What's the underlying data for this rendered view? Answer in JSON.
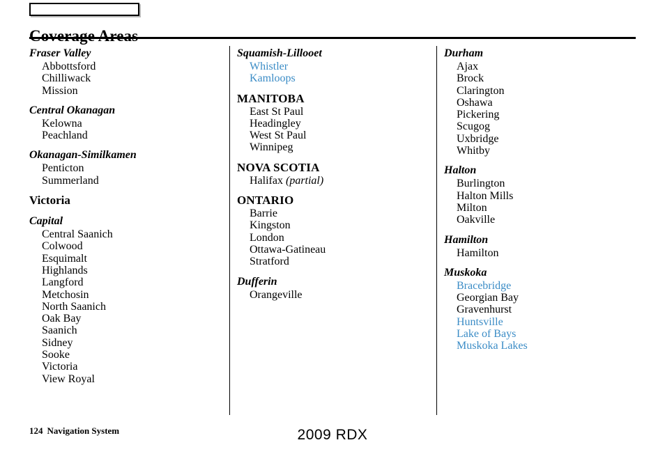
{
  "header": {
    "tab_box_label": "",
    "title": "Coverage Areas"
  },
  "colors": {
    "link": "#3b8cc6",
    "text": "#000000",
    "rule": "#000000"
  },
  "columns": [
    {
      "id": "column-1",
      "groups": [
        {
          "heading": "Fraser Valley",
          "heading_type": "region",
          "cities": [
            {
              "name": "Abbottsford",
              "link": false
            },
            {
              "name": "Chilliwack",
              "link": false
            },
            {
              "name": "Mission",
              "link": false
            }
          ]
        },
        {
          "heading": "Central Okanagan",
          "heading_type": "region",
          "cities": [
            {
              "name": "Kelowna",
              "link": false
            },
            {
              "name": "Peachland",
              "link": false
            }
          ]
        },
        {
          "heading": "Okanagan-Similkamen",
          "heading_type": "region",
          "cities": [
            {
              "name": "Penticton",
              "link": false
            },
            {
              "name": "Summerland",
              "link": false
            }
          ]
        },
        {
          "heading": "Victoria",
          "heading_type": "section",
          "cities": []
        },
        {
          "heading": "Capital",
          "heading_type": "region",
          "cities": [
            {
              "name": "Central Saanich",
              "link": false
            },
            {
              "name": "Colwood",
              "link": false
            },
            {
              "name": "Esquimalt",
              "link": false
            },
            {
              "name": "Highlands",
              "link": false
            },
            {
              "name": "Langford",
              "link": false
            },
            {
              "name": "Metchosin",
              "link": false
            },
            {
              "name": "North Saanich",
              "link": false
            },
            {
              "name": "Oak Bay",
              "link": false
            },
            {
              "name": "Saanich",
              "link": false
            },
            {
              "name": "Sidney",
              "link": false
            },
            {
              "name": "Sooke",
              "link": false
            },
            {
              "name": "Victoria",
              "link": false
            },
            {
              "name": "View Royal",
              "link": false
            }
          ]
        }
      ]
    },
    {
      "id": "column-2",
      "groups": [
        {
          "heading": "Squamish-Lillooet",
          "heading_type": "region",
          "cities": [
            {
              "name": "Whistler",
              "link": true
            },
            {
              "name": "Kamloops",
              "link": true
            }
          ]
        },
        {
          "heading": "MANITOBA",
          "heading_type": "province",
          "cities": [
            {
              "name": "East St Paul",
              "link": false
            },
            {
              "name": "Headingley",
              "link": false
            },
            {
              "name": "West St Paul",
              "link": false
            },
            {
              "name": "Winnipeg",
              "link": false
            }
          ]
        },
        {
          "heading": "NOVA SCOTIA",
          "heading_type": "province",
          "cities": [
            {
              "name": "Halifax",
              "link": false,
              "qualifier": "(partial)"
            }
          ]
        },
        {
          "heading": "ONTARIO",
          "heading_type": "province",
          "cities": [
            {
              "name": "Barrie",
              "link": false
            },
            {
              "name": "Kingston",
              "link": false
            },
            {
              "name": "London",
              "link": false
            },
            {
              "name": "Ottawa-Gatineau",
              "link": false
            },
            {
              "name": "Stratford",
              "link": false
            }
          ]
        },
        {
          "heading": "Dufferin",
          "heading_type": "region",
          "cities": [
            {
              "name": "Orangeville",
              "link": false
            }
          ]
        }
      ]
    },
    {
      "id": "column-3",
      "groups": [
        {
          "heading": "Durham",
          "heading_type": "region",
          "cities": [
            {
              "name": "Ajax",
              "link": false
            },
            {
              "name": "Brock",
              "link": false
            },
            {
              "name": "Clarington",
              "link": false
            },
            {
              "name": "Oshawa",
              "link": false
            },
            {
              "name": "Pickering",
              "link": false
            },
            {
              "name": "Scugog",
              "link": false
            },
            {
              "name": "Uxbridge",
              "link": false
            },
            {
              "name": "Whitby",
              "link": false
            }
          ]
        },
        {
          "heading": "Halton",
          "heading_type": "region",
          "cities": [
            {
              "name": "Burlington",
              "link": false
            },
            {
              "name": "Halton Mills",
              "link": false
            },
            {
              "name": "Milton",
              "link": false
            },
            {
              "name": "Oakville",
              "link": false
            }
          ]
        },
        {
          "heading": "Hamilton",
          "heading_type": "region",
          "cities": [
            {
              "name": "Hamilton",
              "link": false
            }
          ]
        },
        {
          "heading": "Muskoka",
          "heading_type": "region",
          "cities": [
            {
              "name": "Bracebridge",
              "link": true
            },
            {
              "name": "Georgian Bay",
              "link": false
            },
            {
              "name": "Gravenhurst",
              "link": false
            },
            {
              "name": "Huntsville",
              "link": true
            },
            {
              "name": "Lake of Bays",
              "link": true
            },
            {
              "name": "Muskoka Lakes",
              "link": true
            }
          ]
        }
      ]
    }
  ],
  "footer": {
    "page_number": "124",
    "document_title": "Navigation System",
    "model": "2009 RDX"
  }
}
